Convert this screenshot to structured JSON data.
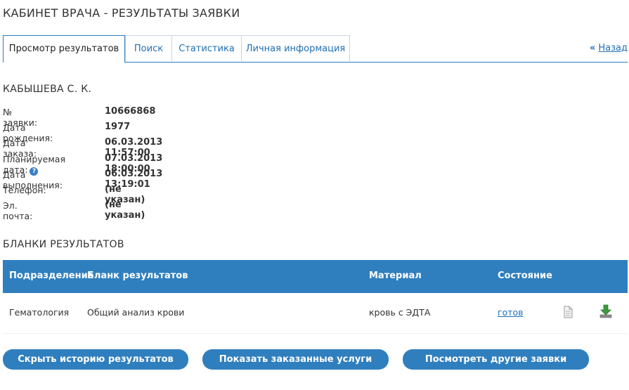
{
  "page": {
    "title": "КАБИНЕТ ВРАЧА - РЕЗУЛЬТАТЫ ЗАЯВКИ"
  },
  "tabs": [
    {
      "label": "Просмотр результатов",
      "active": true
    },
    {
      "label": "Поиск"
    },
    {
      "label": "Статистика"
    },
    {
      "label": "Личная информация"
    }
  ],
  "back_link": {
    "arrows": "«",
    "label": "Назад"
  },
  "patient": {
    "name": "КАБЫШЕВА С. К.",
    "fields": [
      {
        "label": "№ заявки:",
        "value": "10666868"
      },
      {
        "label": "Дата рождения:",
        "value": "1977"
      },
      {
        "label": "Дата заказа:",
        "value": "06.03.2013 11:57:00"
      },
      {
        "label": "Планируемая дата:",
        "value": "07.03.2013 18:00:00",
        "help_icon": "?"
      },
      {
        "label": "Дата выполнения:",
        "value": "06.03.2013 13:19:01"
      },
      {
        "label": "Телефон:",
        "value": "(не указан)"
      },
      {
        "label": "Эл. почта:",
        "value": "(не указан)"
      }
    ]
  },
  "results": {
    "section_title": "БЛАНКИ РЕЗУЛЬТАТОВ",
    "columns": [
      "Подразделение",
      "Бланк результатов",
      "Материал",
      "Состояние"
    ],
    "rows": [
      {
        "department": "Гематология",
        "form": "Общий анализ крови",
        "material": "кровь с ЭДТА",
        "status": "готов",
        "icons": [
          "document-icon",
          "download-icon"
        ]
      }
    ]
  },
  "buttons": [
    {
      "label": "Скрыть историю результатов"
    },
    {
      "label": "Показать заказанные услуги"
    },
    {
      "label": "Посмотреть другие заявки пациента"
    }
  ],
  "colors": {
    "accent": "#2f7fbf",
    "link": "#1f6fb5",
    "download_green": "#3a9a3a"
  }
}
